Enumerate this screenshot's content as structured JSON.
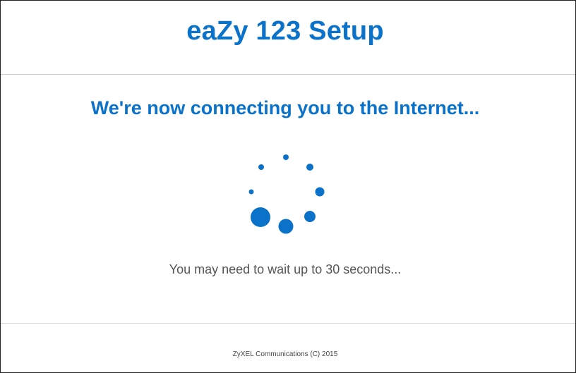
{
  "header": {
    "title": "eaZy 123 Setup"
  },
  "main": {
    "heading": "We're now connecting you to the Internet...",
    "wait_message": "You may need to wait up to 30 seconds...",
    "spinner": {
      "icon": "loading-spinner-icon",
      "color": "#0b72c9"
    }
  },
  "footer": {
    "copyright": "ZyXEL Communications (C) 2015"
  },
  "colors": {
    "accent": "#0b72c9",
    "text_muted": "#555555",
    "divider": "#cfcfcf"
  }
}
